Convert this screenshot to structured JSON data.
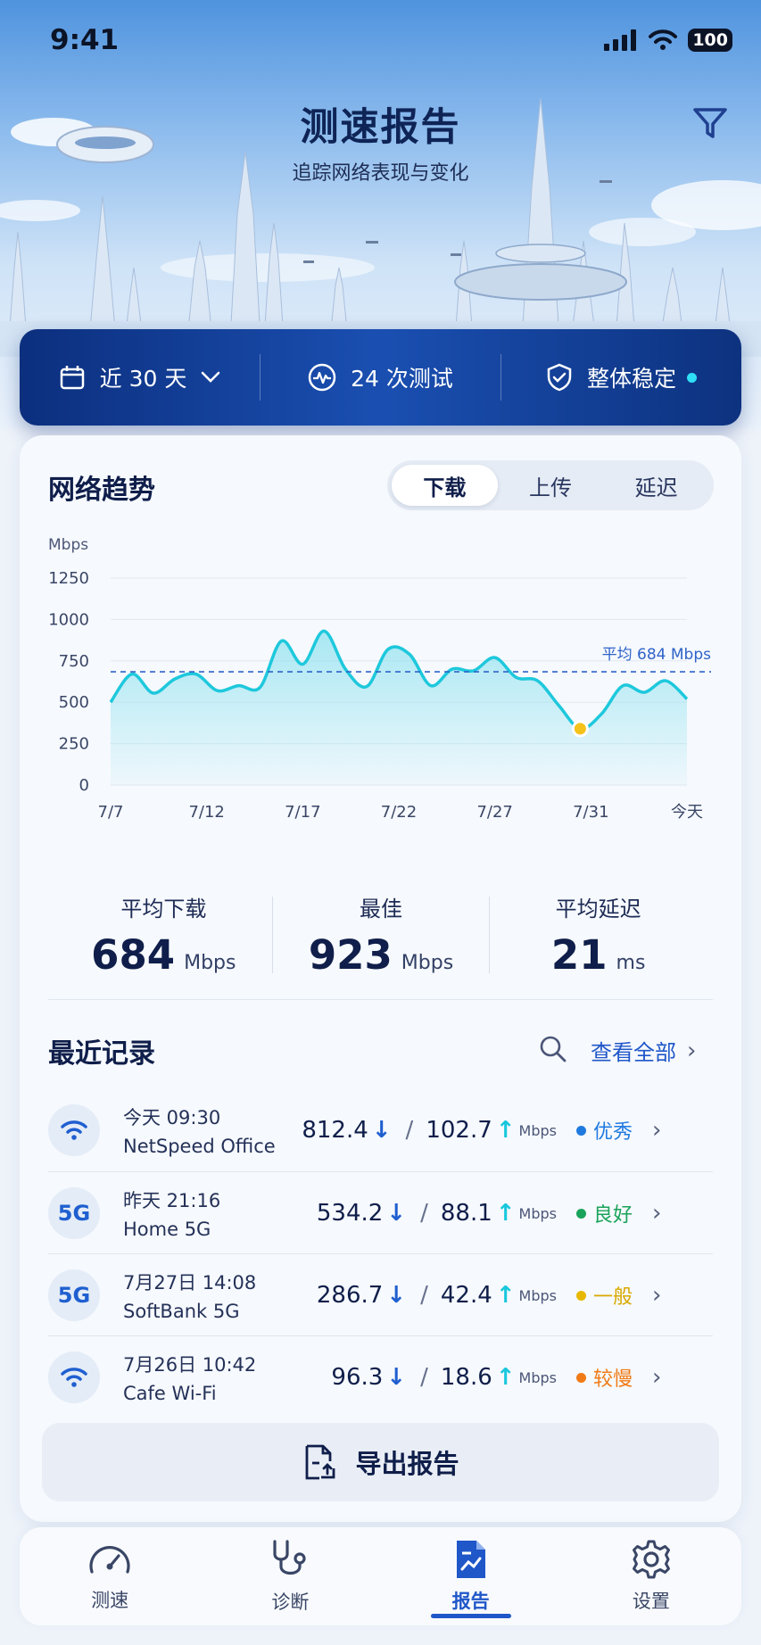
{
  "status_bar": {
    "time": "9:41",
    "battery": "100"
  },
  "header": {
    "title": "测速报告",
    "subtitle": "追踪网络表现与变化"
  },
  "summary": {
    "period": "近 30 天",
    "tests": "24 次测试",
    "stability": "整体稳定"
  },
  "trend": {
    "title": "网络趋势",
    "tabs": [
      "下载",
      "上传",
      "延迟"
    ],
    "active_tab": "下载"
  },
  "chart_data": {
    "type": "area",
    "ylabel": "Mbps",
    "ylim": [
      0,
      1250
    ],
    "yticks": [
      0,
      250,
      500,
      750,
      1000,
      1250
    ],
    "x_tick_labels": [
      "7/7",
      "7/12",
      "7/17",
      "7/22",
      "7/27",
      "7/31",
      "今天"
    ],
    "series": [
      {
        "values": [
          500,
          670,
          555,
          640,
          670,
          570,
          600,
          590,
          870,
          730,
          930,
          700,
          595,
          820,
          790,
          600,
          700,
          690,
          770,
          650,
          630,
          480,
          340,
          430,
          600,
          560,
          630,
          520
        ]
      }
    ],
    "average": {
      "value": 684,
      "label": "平均 684 Mbps"
    },
    "highlight": {
      "index": 22,
      "value": 340
    },
    "grid": true,
    "colors": {
      "line": "#1ec8dc",
      "fill": "#8fe2f0",
      "average": "#2f63c9",
      "highlight": "#f5c21b"
    }
  },
  "stats": [
    {
      "label": "平均下载",
      "value": "684",
      "unit": "Mbps"
    },
    {
      "label": "最佳",
      "value": "923",
      "unit": "Mbps"
    },
    {
      "label": "平均延迟",
      "value": "21",
      "unit": "ms"
    }
  ],
  "records": {
    "title": "最近记录",
    "view_all": "查看全部",
    "unit": "Mbps",
    "items": [
      {
        "icon": "wifi-icon",
        "time": "今天 09:30",
        "name": "NetSpeed Office",
        "down": "812.4",
        "up": "102.7",
        "status": "优秀",
        "status_color": "#1f7ae0"
      },
      {
        "icon": "5g-icon",
        "badge": "5G",
        "time": "昨天 21:16",
        "name": "Home 5G",
        "down": "534.2",
        "up": "88.1",
        "status": "良好",
        "status_color": "#1aa35a"
      },
      {
        "icon": "5g-icon",
        "badge": "5G",
        "time": "7月27日 14:08",
        "name": "SoftBank 5G",
        "down": "286.7",
        "up": "42.4",
        "status": "一般",
        "status_color": "#e8b800"
      },
      {
        "icon": "wifi-icon",
        "time": "7月26日 10:42",
        "name": "Cafe Wi-Fi",
        "down": "96.3",
        "up": "18.6",
        "status": "较慢",
        "status_color": "#f07b16"
      }
    ]
  },
  "export": {
    "label": "导出报告"
  },
  "tabbar": {
    "items": [
      {
        "label": "测速",
        "icon": "speedometer-icon"
      },
      {
        "label": "诊断",
        "icon": "stethoscope-icon"
      },
      {
        "label": "报告",
        "icon": "report-icon"
      },
      {
        "label": "设置",
        "icon": "gear-icon"
      }
    ],
    "active": 2
  }
}
